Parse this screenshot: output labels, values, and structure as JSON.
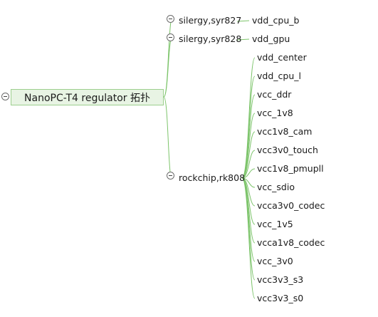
{
  "root": {
    "label": "NanoPC-T4 regulator 拓扑"
  },
  "branches": [
    {
      "label": "silergy,syr827",
      "children": [
        "vdd_cpu_b"
      ]
    },
    {
      "label": "silergy,syr828",
      "children": [
        "vdd_gpu"
      ]
    },
    {
      "label": "rockchip,rk808",
      "children": [
        "vdd_center",
        "vdd_cpu_l",
        "vcc_ddr",
        "vcc_1v8",
        "vcc1v8_cam",
        "vcc3v0_touch",
        "vcc1v8_pmupll",
        "vcc_sdio",
        "vcca3v0_codec",
        "vcc_1v5",
        "vcca1v8_codec",
        "vcc_3v0",
        "vcc3v3_s3",
        "vcc3v3_s0"
      ]
    }
  ],
  "colors": {
    "connector": "#7cc46a",
    "root_fill": "#e8f4e4",
    "root_border": "#9ccf8e"
  }
}
